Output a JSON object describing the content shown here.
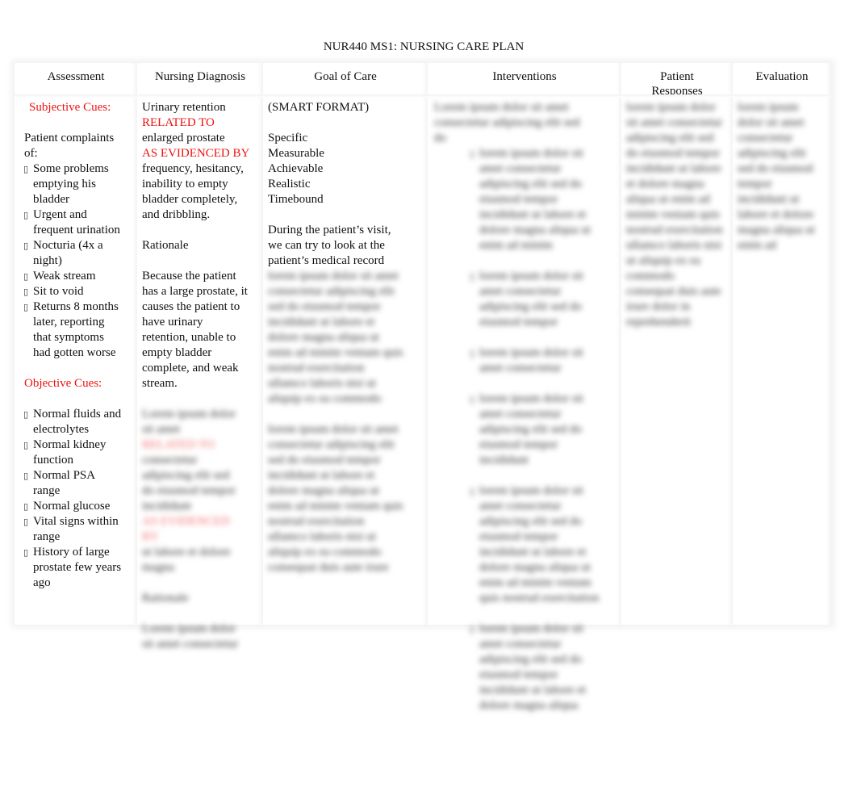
{
  "document": {
    "title": "NUR440 MS1: NURSING CARE PLAN"
  },
  "headers": {
    "assessment": "Assessment",
    "diagnosis": "Nursing Diagnosis",
    "goal": "Goal of Care",
    "interventions": "Interventions",
    "responses_line1": "Patient",
    "responses_line2": "Responses",
    "evaluation": "Evaluation"
  },
  "assessment": {
    "subjective_label": "Subjective Cues:",
    "intro": "Patient complaints of:",
    "subjective_items": [
      "Some problems emptying his bladder",
      "Urgent and frequent urination",
      "Nocturia (4x a night)",
      "Weak stream",
      "Sit to void",
      "Returns 8 months later, reporting that symptoms had gotten worse"
    ],
    "objective_label": "Objective Cues:",
    "objective_items": [
      "Normal fluids and electrolytes",
      "Normal kidney function",
      "Normal PSA range",
      "Normal glucose",
      "Vital signs within range",
      "History of large prostate few years ago"
    ],
    "bullet_glyph": "▯"
  },
  "diagnosis": {
    "line1": "Urinary retention",
    "related_to": "RELATED TO",
    "line2": "enlarged prostate",
    "evidenced_by": "AS EVIDENCED BY",
    "line3": "frequency, hesitancy, inability to empty bladder completely, and dribbling.",
    "rationale_label": "Rationale",
    "rationale": "Because the patient has a large prostate, it causes the patient to have urinary retention, unable to empty bladder complete, and weak stream.",
    "blurred_text_1": "Lorem ipsum dolor sit amet",
    "blurred_red_1": "RELATED TO",
    "blurred_text_2": "consectetur adipiscing elit sed do eiusmod tempor incididunt",
    "blurred_red_2": "AS EVIDENCED BY",
    "blurred_text_3": "ut labore et dolore magna",
    "blurred_text_4": "Rationale",
    "blurred_text_5": "Lorem ipsum dolor sit amet consectetur"
  },
  "goal": {
    "format_label": "(SMART FORMAT)",
    "smart": [
      "Specific",
      "Measurable",
      "Achievable",
      "Realistic",
      "Timebound"
    ],
    "text": "During the patient’s visit, we can try to look at the patient’s medical record",
    "blurred_text_1": "lorem ipsum dolor sit amet consectetur adipiscing elit sed do eiusmod tempor incididunt ut labore et dolore magna aliqua ut enim ad minim veniam quis nostrud exercitation ullamco laboris nisi ut aliquip ex ea commodo",
    "blurred_text_2": "lorem ipsum dolor sit amet consectetur adipiscing elit sed do eiusmod tempor incididunt ut labore et dolore magna aliqua ut enim ad minim veniam quis nostrud exercitation ullamco laboris nisi ut aliquip ex ea commodo consequat duis aute irure"
  },
  "interventions": {
    "blurred_intro": "Lorem ipsum dolor sit amet consectetur adipiscing elit sed do",
    "blurred_items": [
      "lorem ipsum dolor sit amet consectetur adipiscing elit sed do eiusmod tempor incididunt ut labore et dolore magna aliqua ut enim ad minim",
      "lorem ipsum dolor sit amet consectetur adipiscing elit sed do eiusmod tempor",
      "lorem ipsum dolor sit amet consectetur",
      "lorem ipsum dolor sit amet consectetur adipiscing elit sed do eiusmod tempor incididunt",
      "lorem ipsum dolor sit amet consectetur adipiscing elit sed do eiusmod tempor incididunt ut labore et dolore magna aliqua ut enim ad minim veniam quis nostrud exercitation",
      "lorem ipsum dolor sit amet consectetur adipiscing elit sed do eiusmod tempor incididunt ut labore et dolore magna aliqua"
    ]
  },
  "responses": {
    "blurred_text": "lorem ipsum dolor sit amet consectetur adipiscing elit sed do eiusmod tempor incididunt ut labore et dolore magna aliqua ut enim ad minim veniam quis nostrud exercitation ullamco laboris nisi ut aliquip ex ea commodo consequat duis aute irure dolor in reprehenderit"
  },
  "evaluation": {
    "blurred_text": "lorem ipsum dolor sit amet consectetur adipiscing elit sed do eiusmod tempor incididunt ut labore et dolore magna aliqua ut enim ad"
  }
}
